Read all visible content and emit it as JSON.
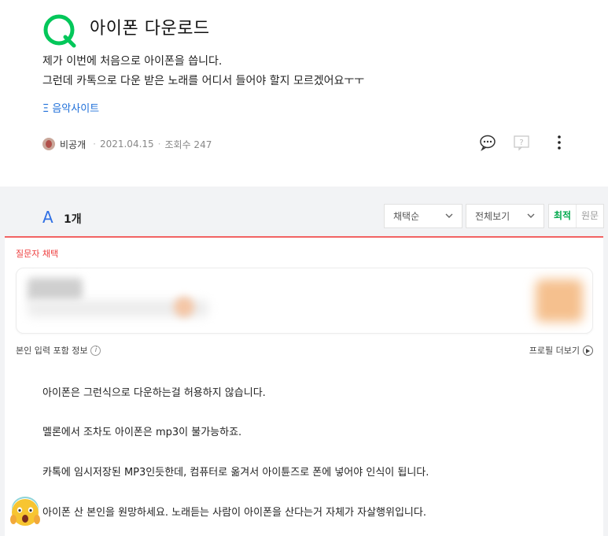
{
  "question": {
    "title": "아이폰 다운로드",
    "body_lines": [
      "제가 이번에 처음으로 아이폰을 씁니다.",
      "그런데 카톡으로 다운 받은 노래를 어디서 들어야 할지 모르겠어요ㅜㅜ"
    ],
    "tag": "Ξ 음악사이트",
    "author": "비공개",
    "date": "2021.04.15",
    "views": "조회수 247"
  },
  "answers": {
    "letter": "A",
    "count": "1개",
    "sort_select": "채택순",
    "filter_select": "전체보기",
    "toggle_on": "최적",
    "toggle_off": "원문"
  },
  "answer": {
    "chosen_label": "질문자 채택",
    "info_label": "본인 입력 포함 정보",
    "info_icon": "i",
    "profile_link": "프로필 더보기",
    "paragraphs": [
      "아이폰은 그런식으로 다운하는걸 허용하지 않습니다.",
      "멜론에서 조차도 아이폰은 mp3이 불가능하죠.",
      "카톡에 임시저장된 MP3인듯한데, 컴퓨터로 옮겨서 아이튠즈로 폰에 넣어야 인식이 됩니다.",
      "아이폰 산 본인을 원망하세요. 노래듣는 사람이 아이폰을 산다는거 자체가 자살행위입니다."
    ]
  },
  "colors": {
    "q_green": "#03c75a",
    "a_blue": "#2f6fe4",
    "chosen_red": "#ee3e3e",
    "best_green": "#03a94d"
  },
  "icons": [
    "q-icon",
    "comment-icon",
    "report-icon",
    "more-icon",
    "chevron-down-icon",
    "info-icon",
    "arrow-circle-icon",
    "screaming-face-emoji"
  ]
}
